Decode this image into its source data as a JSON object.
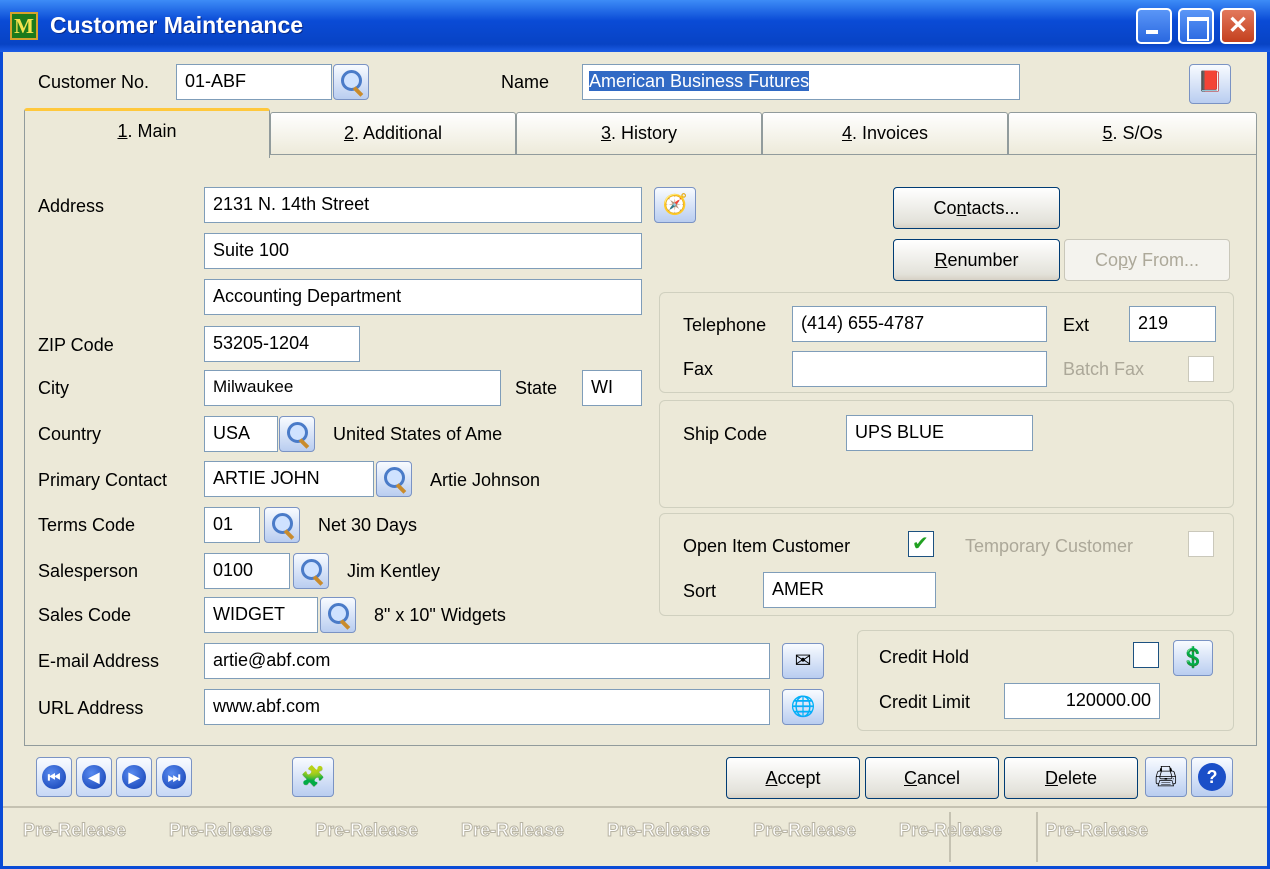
{
  "window": {
    "title": "Customer Maintenance",
    "icon_letter": "M"
  },
  "header": {
    "customer_no_label": "Customer No.",
    "customer_no": "01-ABF",
    "name_label": "Name",
    "name": "American Business Futures"
  },
  "tabs": [
    {
      "key": "1",
      "label": ". Main"
    },
    {
      "key": "2",
      "label": ". Additional"
    },
    {
      "key": "3",
      "label": ". History"
    },
    {
      "key": "4",
      "label": ". Invoices"
    },
    {
      "key": "5",
      "label": ". S/Os"
    }
  ],
  "main": {
    "address_label": "Address",
    "address1": "2131 N. 14th Street",
    "address2": "Suite 100",
    "address3": "Accounting Department",
    "zip_label": "ZIP Code",
    "zip": "53205-1204",
    "city_label": "City",
    "city": "Milwaukee",
    "state_label": "State",
    "state": "WI",
    "country_label": "Country",
    "country": "USA",
    "country_desc": "United States of Ame",
    "contact_label": "Primary Contact",
    "contact": "ARTIE JOHN",
    "contact_desc": "Artie Johnson",
    "terms_label": "Terms Code",
    "terms": "01",
    "terms_desc": "Net 30 Days",
    "salesperson_label": "Salesperson",
    "salesperson": "0100",
    "salesperson_desc": "Jim Kentley",
    "salescode_label": "Sales Code",
    "salescode": "WIDGET",
    "salescode_desc": "8\" x 10\" Widgets",
    "email_label": "E-mail Address",
    "email": "artie@abf.com",
    "url_label": "URL Address",
    "url": "www.abf.com"
  },
  "right": {
    "contacts_pre": "Co",
    "contacts_u": "n",
    "contacts_post": "tacts...",
    "renumber_u": "R",
    "renumber_post": "enumber",
    "copyfrom_pre": "Co",
    "copyfrom_u": "p",
    "copyfrom_post": "y From...",
    "telephone_label": "Telephone",
    "telephone": "(414) 655-4787",
    "ext_label": "Ext",
    "ext": "219",
    "fax_label": "Fax",
    "fax": "",
    "batchfax_label": "Batch Fax",
    "shipcode_label": "Ship Code",
    "shipcode": "UPS BLUE",
    "openitem_label": "Open Item Customer",
    "temporary_label": "Temporary Customer",
    "sort_label": "Sort",
    "sort": "AMER",
    "credithold_label": "Credit Hold",
    "creditlimit_label": "Credit Limit",
    "creditlimit": "120000.00"
  },
  "footer": {
    "accept_u": "A",
    "accept_post": "ccept",
    "cancel_u": "C",
    "cancel_post": "ancel",
    "delete_u": "D",
    "delete_post": "elete",
    "help": "?"
  },
  "status": {
    "watermark": "Pre-Release"
  }
}
